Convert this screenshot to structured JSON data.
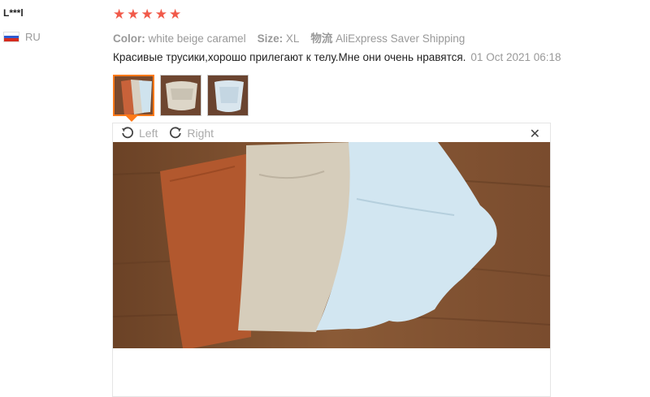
{
  "reviewer": {
    "name": "L***l",
    "country_code": "RU",
    "flag_colors": [
      "#ffffff",
      "#2f5bd1",
      "#d52b1e"
    ]
  },
  "rating": {
    "stars": 5,
    "max": 5,
    "star_color": "#f15a4a",
    "star_glyph": "★"
  },
  "sku": {
    "color_label": "Color:",
    "color_value": "white beige caramel",
    "size_label": "Size:",
    "size_value": "XL",
    "shipping_label": "物流",
    "shipping_value": "AliExpress Saver Shipping"
  },
  "review": {
    "text": "Красивые трусики,хорошо прилегают к телу.Мне они очень нравятся.",
    "date": "01 Oct 2021 06:18"
  },
  "thumbnails": [
    {
      "name": "photo-1",
      "active": true
    },
    {
      "name": "photo-2",
      "active": false
    },
    {
      "name": "photo-3",
      "active": false
    }
  ],
  "viewer": {
    "rotate_left_label": "Left",
    "rotate_right_label": "Right",
    "close_glyph": "✕",
    "accent_color": "#ff7a1a"
  }
}
